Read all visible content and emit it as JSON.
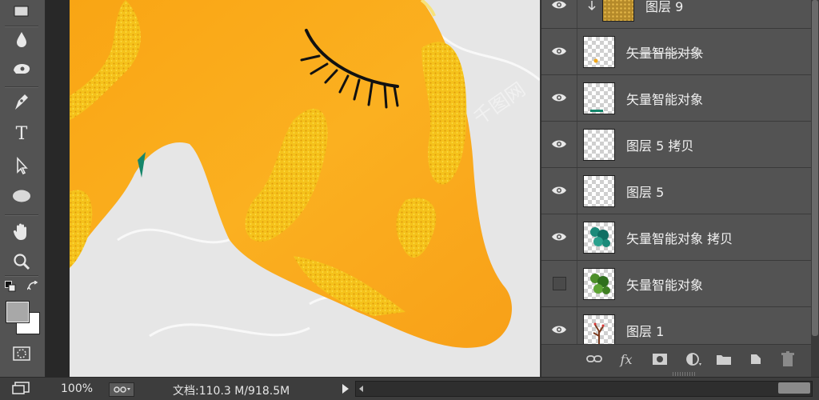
{
  "toolbar": {
    "tools": [
      "rectangle-swatch-icon",
      "blur-drop-icon",
      "sponge-icon",
      "pen-tool-icon",
      "type-tool-icon",
      "path-select-icon",
      "ellipse-tool-icon",
      "hand-tool-icon",
      "zoom-tool-icon",
      "default-colors-icon",
      "swap-colors-icon",
      "color-swatches-icon",
      "quick-mask-icon",
      "screen-mode-icon"
    ],
    "type_tool_label": "T"
  },
  "canvas": {
    "background_color": "#e8e8e8",
    "character_color": "#f7a21a",
    "watermark_text": "千图网"
  },
  "layers": {
    "rows": [
      {
        "name": "图层 9",
        "visible": true,
        "thumb": "gold-texture",
        "clipped": true
      },
      {
        "name": "矢量智能对象",
        "visible": true,
        "thumb": "transparent-dot",
        "strike": true
      },
      {
        "name": "矢量智能对象",
        "visible": true,
        "thumb": "transparent-teal"
      },
      {
        "name": "图层 5 拷贝",
        "visible": true,
        "thumb": "transparent"
      },
      {
        "name": "图层 5",
        "visible": true,
        "thumb": "transparent"
      },
      {
        "name": "矢量智能对象 拷贝",
        "visible": true,
        "thumb": "teal-tree"
      },
      {
        "name": "矢量智能对象",
        "visible": false,
        "thumb": "green-tree"
      },
      {
        "name": "图层 1",
        "visible": true,
        "thumb": "branch"
      }
    ],
    "footer_icons": [
      "link-layers-icon",
      "fx-icon",
      "add-mask-icon",
      "adjustment-layer-icon",
      "new-group-icon",
      "new-layer-icon",
      "delete-layer-icon"
    ],
    "fx_label": "fx"
  },
  "status": {
    "zoom": "100%",
    "doc_info": "文档:110.3 M/918.5M"
  }
}
